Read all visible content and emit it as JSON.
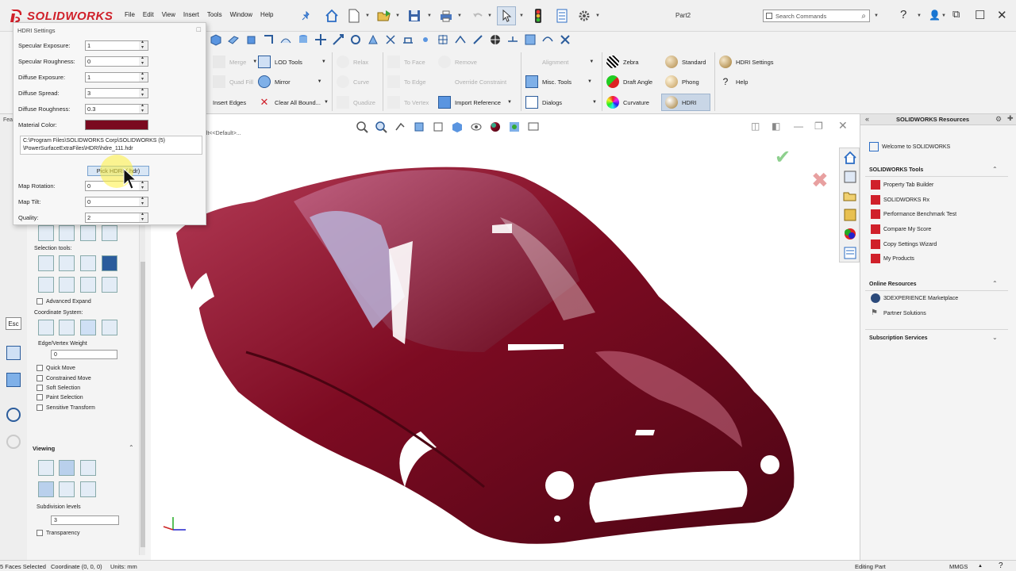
{
  "app": {
    "brand": "SOLIDWORKS",
    "document_title": "Part2",
    "menus": [
      "File",
      "Edit",
      "View",
      "Insert",
      "Tools",
      "Window",
      "Help"
    ],
    "search_placeholder": "Search Commands"
  },
  "command_manager": {
    "col1": [
      "Merge",
      "Quad Fill",
      "Insert Edges"
    ],
    "col2": [
      "LOD Tools",
      "Mirror",
      "Clear All Bound..."
    ],
    "col3": [
      "Relax",
      "Curve",
      "Quadize"
    ],
    "col4": [
      "To Face",
      "To Edge",
      "To Vertex"
    ],
    "col5": [
      "Remove",
      "Override Constraint",
      "Import Reference"
    ],
    "col6": [
      "Alignment",
      "Misc. Tools",
      "Dialogs"
    ],
    "col7": [
      "Zebra",
      "Draft Angle",
      "Curvature"
    ],
    "col8": [
      "Standard",
      "Phong",
      "HDRI"
    ],
    "col9": [
      "HDRI Settings",
      "Help"
    ],
    "accent_active": "#c9d6e6"
  },
  "hdri_dialog": {
    "title": "HDRI Settings",
    "fields": [
      {
        "label": "Specular Exposure:",
        "value": "1"
      },
      {
        "label": "Specular Roughness:",
        "value": "0"
      },
      {
        "label": "Diffuse Exposure:",
        "value": "1"
      },
      {
        "label": "Diffuse Spread:",
        "value": "3"
      },
      {
        "label": "Diffuse Roughness:",
        "value": "0.3"
      }
    ],
    "material_color_label": "Material Color:",
    "material_color": "#7a0a20",
    "file_path_line1": "C:\\Program Files\\SOLIDWORKS Corp\\SOLIDWORKS (5)",
    "file_path_line2": "\\PowerSurfaceExtraFiles\\HDRI\\hdre_111.hdr",
    "pick_button": "Pick HDRI (.hdr)",
    "fields2": [
      {
        "label": "Map Rotation:",
        "value": "0"
      },
      {
        "label": "Map Tilt:",
        "value": "0"
      },
      {
        "label": "Quality:",
        "value": "2"
      }
    ]
  },
  "left_pane": {
    "tab_label": "Fea",
    "selection_tools_label": "Selection tools:",
    "advanced_expand": "Advanced Expand",
    "coordinate_system": "Coordinate System:",
    "edge_vertex_weight": "Edge/Vertex Weight",
    "edge_vertex_value": "0",
    "checks": [
      "Quick Move",
      "Constrained Move",
      "Soft Selection",
      "Paint Selection",
      "Sensitive Transform"
    ],
    "viewing": "Viewing",
    "subdivision_levels": "Subdivision levels",
    "subdivision_value": "3",
    "transparency": "Transparency",
    "esc": "Esc"
  },
  "viewport": {
    "tree_text": "ult<<Default>...",
    "body_color": "#7d0b22"
  },
  "task_pane": {
    "title": "SOLIDWORKS Resources",
    "welcome": "Welcome to SOLIDWORKS",
    "sections": [
      {
        "title": "SOLIDWORKS Tools",
        "items": [
          "Property Tab Builder",
          "SOLIDWORKS Rx",
          "Performance Benchmark Test",
          "Compare My Score",
          "Copy Settings Wizard",
          "My Products"
        ]
      },
      {
        "title": "Online Resources",
        "items": [
          "3DEXPERIENCE Marketplace",
          "Partner Solutions"
        ]
      },
      {
        "title": "Subscription Services",
        "items": []
      }
    ]
  },
  "status_bar": {
    "selection": "5 Faces Selected",
    "coordinate": "Coordinate (0, 0, 0)",
    "units": "Units: mm",
    "mode": "Editing Part",
    "unit_system": "MMGS"
  }
}
